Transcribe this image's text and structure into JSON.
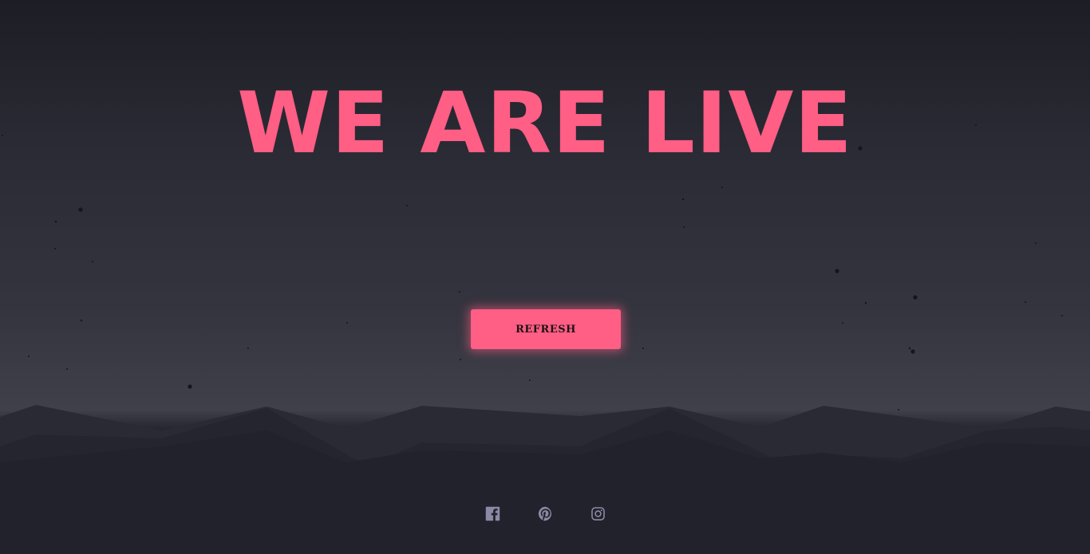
{
  "hero": {
    "title": "WE ARE LIVE"
  },
  "actions": {
    "refresh_label": "REFRESH"
  },
  "social": [
    {
      "name": "facebook",
      "icon": "facebook-icon"
    },
    {
      "name": "pinterest",
      "icon": "pinterest-icon"
    },
    {
      "name": "instagram",
      "icon": "instagram-icon"
    }
  ],
  "colors": {
    "accent": "#ff5e85",
    "background_top": "#1d1d25",
    "background_horizon": "#40404a",
    "ground": "#22222c",
    "icon": "#8a8aa6"
  }
}
